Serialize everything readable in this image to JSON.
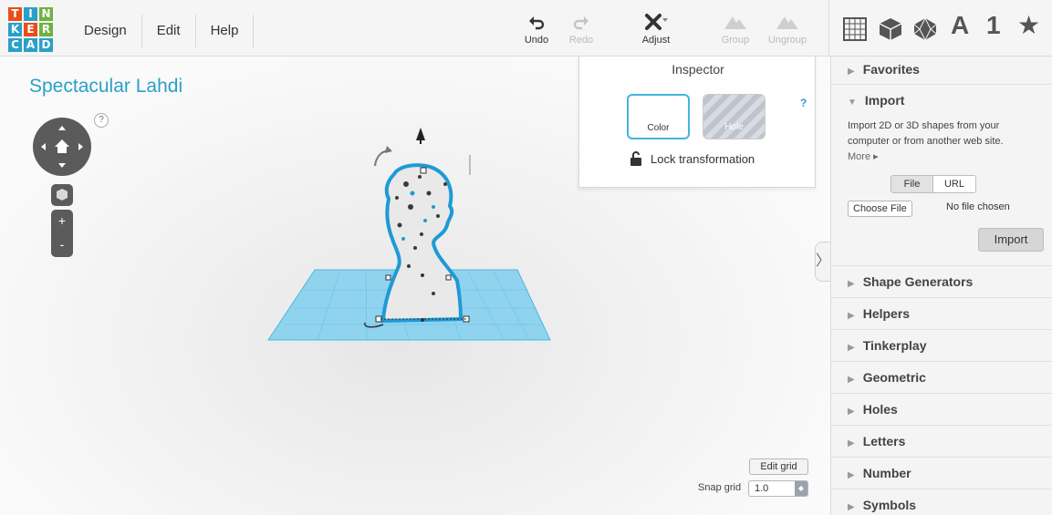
{
  "app": {
    "logo_letters": [
      "T",
      "I",
      "N",
      "K",
      "E",
      "R",
      "C",
      "A",
      "D"
    ],
    "logo_colors": [
      "#e84e1b",
      "#2aa0c8",
      "#6db33f",
      "#2aa0c8",
      "#e84e1b",
      "#6db33f",
      "#2aa0c8",
      "#2aa0c8",
      "#2aa0c8"
    ],
    "project_title": "Spectacular Lahdi"
  },
  "menu": [
    "Design",
    "Edit",
    "Help"
  ],
  "toolbar": {
    "undo": "Undo",
    "redo": "Redo",
    "adjust": "Adjust",
    "group": "Group",
    "ungroup": "Ungroup"
  },
  "shape_icons": [
    "grid-icon",
    "cube-icon",
    "polyhedron-icon",
    "letter-a-icon",
    "number-one-icon",
    "star-icon"
  ],
  "shape_icon_glyphs": {
    "letter": "A",
    "number": "1",
    "star": "★"
  },
  "view_controls": {
    "help": "?",
    "zoom_in": "+",
    "zoom_out": "-"
  },
  "inspector": {
    "title": "Inspector",
    "color_label": "Color",
    "hole_label": "Hole",
    "help": "?",
    "lock_label": "Lock transformation"
  },
  "grid": {
    "edit_grid": "Edit grid",
    "snap_label": "Snap grid",
    "snap_value": "1.0"
  },
  "sidebar": {
    "favorites": "Favorites",
    "import": "Import",
    "import_desc": "Import 2D or 3D shapes from your computer or from another web site.",
    "more": "More ▸",
    "tab_file": "File",
    "tab_url": "URL",
    "choose_file": "Choose File",
    "no_file": "No file chosen",
    "import_button": "Import",
    "sections": [
      "Shape Generators",
      "Helpers",
      "Tinkerplay",
      "Geometric",
      "Holes",
      "Letters",
      "Number",
      "Symbols"
    ]
  },
  "colors": {
    "accent": "#2aa0c8",
    "workplane_grid": "#7fd0f0",
    "selection": "#1e9ad6"
  }
}
